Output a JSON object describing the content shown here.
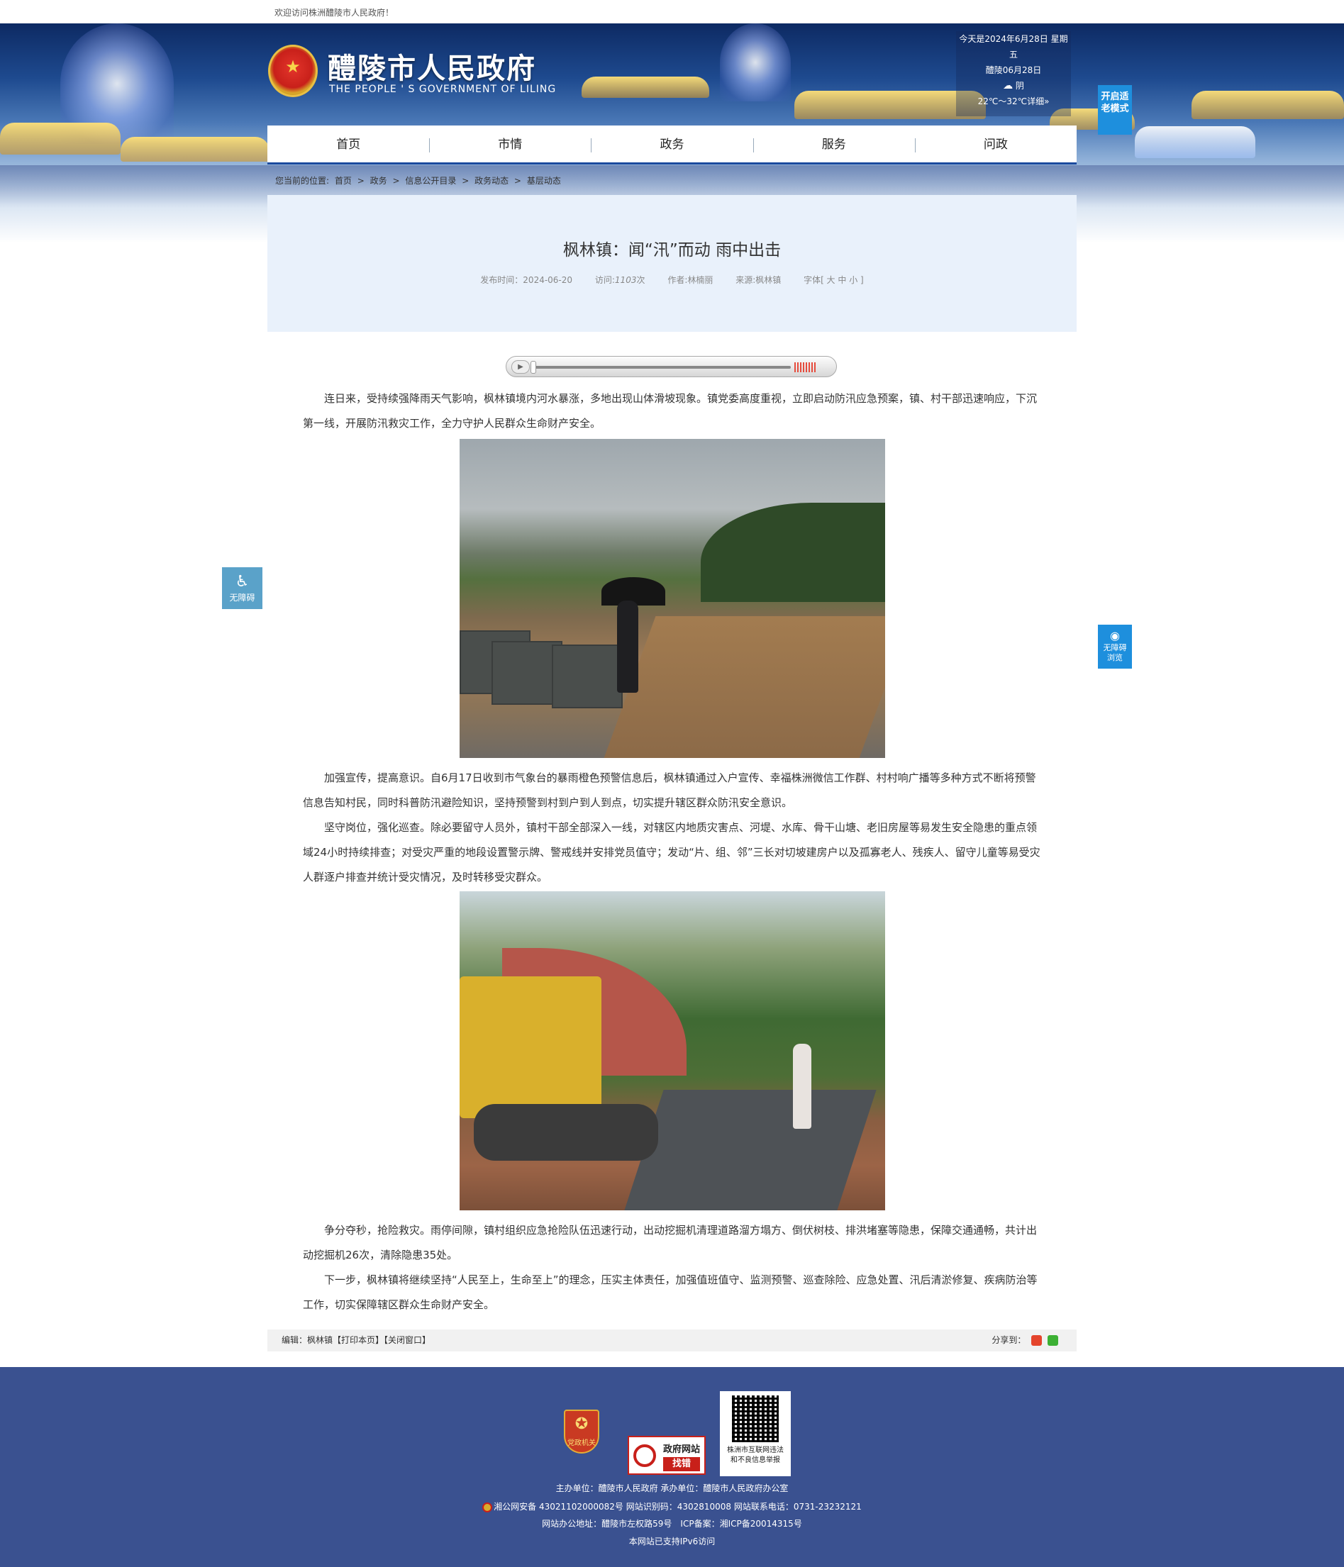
{
  "topbar": {
    "welcome": "欢迎访问株洲醴陵市人民政府！"
  },
  "header": {
    "site_title": "醴陵市人民政府",
    "site_subtitle": "THE PEOPLE ' S GOVERNMENT OF LILING",
    "weather": {
      "date": "今天是2024年6月28日 星期五",
      "local_date": "醴陵06月28日",
      "condition": "阴",
      "temperature": "22℃～32℃详细»"
    },
    "elder_mode_button": "开启适老模式"
  },
  "nav": {
    "items": [
      "首页",
      "市情",
      "政务",
      "服务",
      "问政"
    ]
  },
  "breadcrumb": {
    "prefix": "您当前的位置:",
    "items": [
      "首页",
      "政务",
      "信息公开目录",
      "政务动态",
      "基层动态"
    ],
    "separator": ">"
  },
  "article": {
    "title": "枫林镇：闻“汛”而动 雨中出击",
    "meta": {
      "publish_time": "发布时间：2024-06-20",
      "visits_label": "访问:",
      "visits": "1103",
      "visits_unit": "次",
      "author": "作者:林楠丽",
      "source": "来源:枫林镇",
      "font_size": "字体[ 大 中 小 ]"
    },
    "paragraphs": [
      "连日来，受持续强降雨天气影响，枫林镇境内河水暴涨，多地出现山体滑坡现象。镇党委高度重视，立即启动防汛应急预案，镇、村干部迅速响应，下沉第一线，开展防汛救灾工作，全力守护人民群众生命财产安全。",
      "加强宣传，提高意识。自6月17日收到市气象台的暴雨橙色预警信息后，枫林镇通过入户宣传、幸福株洲微信工作群、村村响广播等多种方式不断将预警信息告知村民，同时科普防汛避险知识，坚持预警到村到户到人到点，切实提升辖区群众防汛安全意识。",
      "坚守岗位，强化巡查。除必要留守人员外，镇村干部全部深入一线，对辖区内地质灾害点、河堤、水库、骨干山塘、老旧房屋等易发生安全隐患的重点领域24小时持续排查；对受灾严重的地段设置警示牌、警戒线并安排党员值守；发动“片、组、邻”三长对切坡建房户以及孤寡老人、残疾人、留守儿童等易受灾人群逐户排查并统计受灾情况，及时转移受灾群众。",
      "争分夺秒，抢险救灾。雨停间隙，镇村组织应急抢险队伍迅速行动，出动挖掘机清理道路溜方塌方、倒伏树枝、排洪堵塞等隐患，保障交通通畅，共计出动挖掘机26次，清除隐患35处。",
      "下一步，枫林镇将继续坚持“人民至上，生命至上”的理念，压实主体责任，加强值班值守、监测预警、巡查除险、应急处置、汛后清淤修复、疾病防治等工作，切实保障辖区群众生命财产安全。"
    ]
  },
  "editor_bar": {
    "editor": "编辑：枫林镇",
    "print": "【打印本页】",
    "close": "【关闭窗口】",
    "share_label": "分享到："
  },
  "accessibility": {
    "left_label": "无障碍",
    "right_label_1": "无障碍",
    "right_label_2": "浏览"
  },
  "footer": {
    "party_badge": "党政机关",
    "error_badge_top": "政府网站",
    "error_badge_bottom": "找错",
    "qr_caption_1": "株洲市互联网违法",
    "qr_caption_2": "和不良信息举报",
    "sponsor": "主办单位：醴陵市人民政府 承办单位：醴陵市人民政府办公室",
    "record": "湘公网安备 43021102000082号 网站识别码：4302810008 网站联系电话：0731-23232121",
    "address": "网站办公地址：醴陵市左权路59号　ICP备案：湘ICP备20014315号",
    "ipv6": "本网站已支持IPv6访问"
  },
  "colors": {
    "nav_border": "#1b4a9e",
    "footer_bg": "#3a5190",
    "title_bg": "#e9f1fb",
    "accent_blue": "#1e8fdd"
  }
}
